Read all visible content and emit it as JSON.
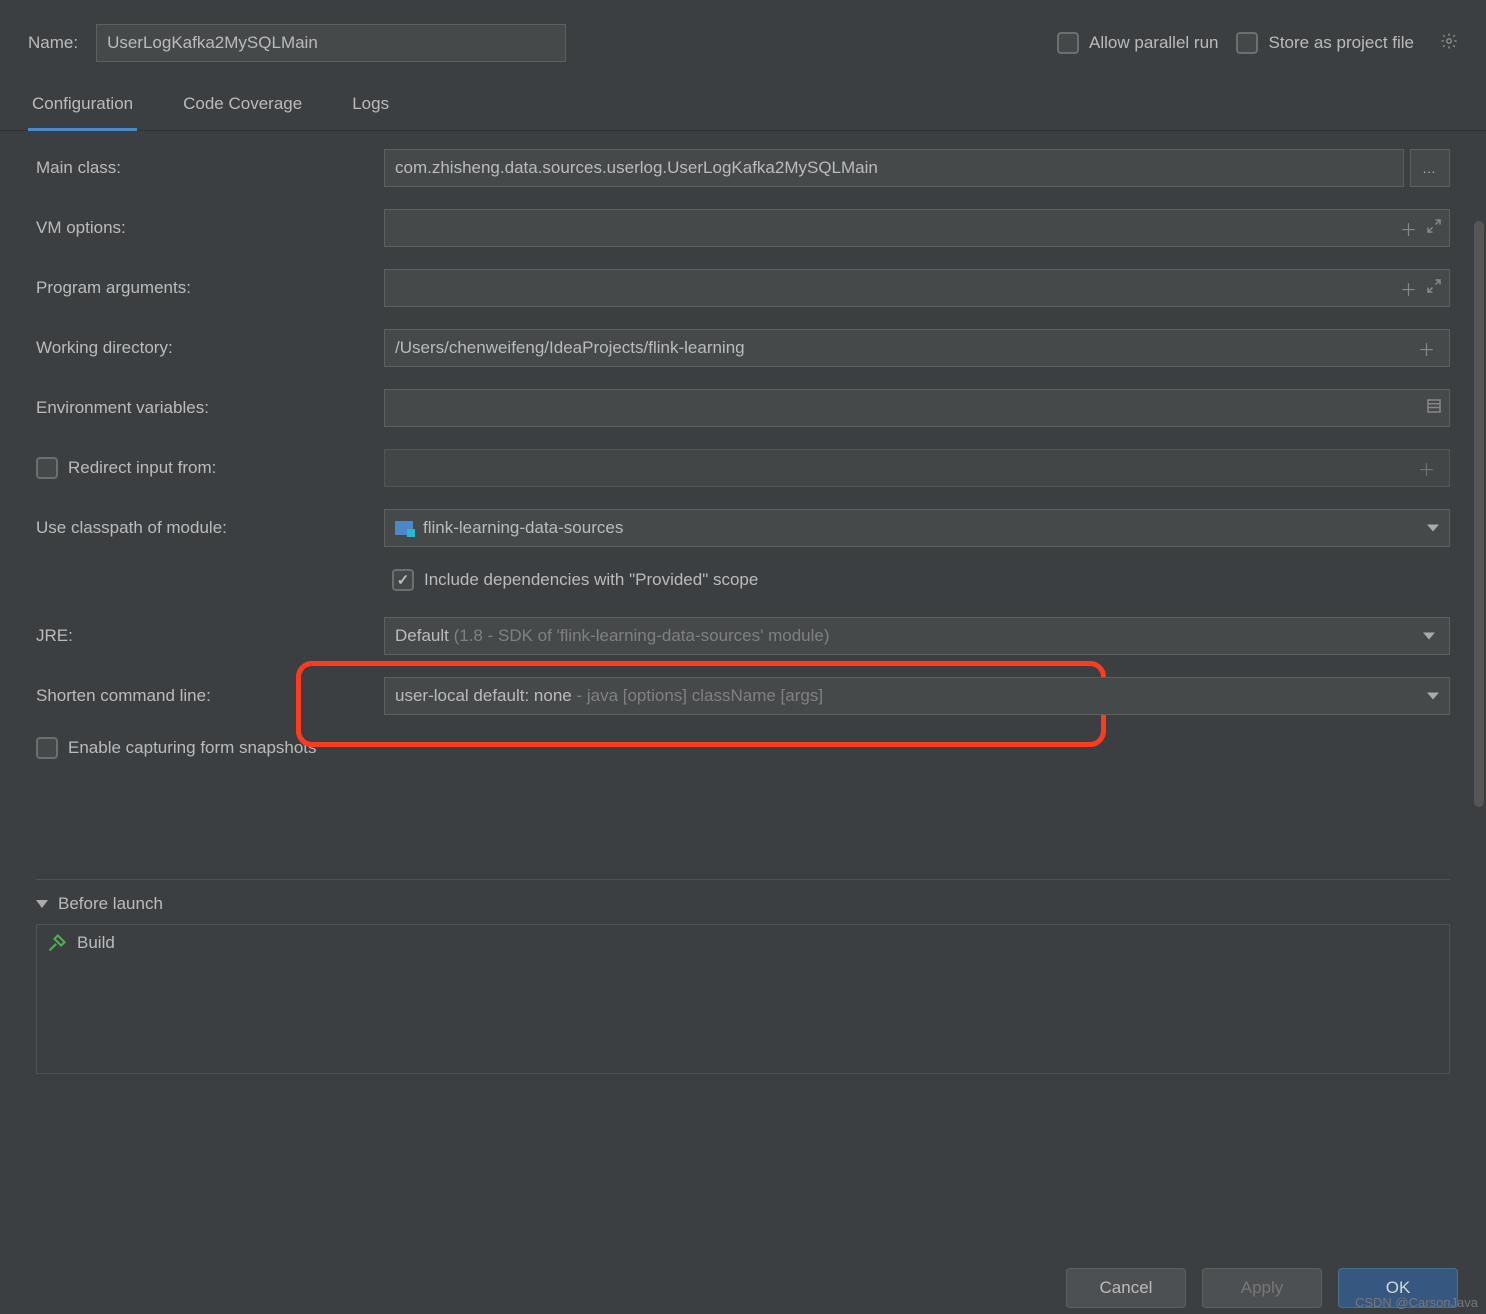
{
  "header": {
    "name_label": "Name:",
    "name_value": "UserLogKafka2MySQLMain",
    "allow_parallel": "Allow parallel run",
    "store_project": "Store as project file"
  },
  "tabs": [
    "Configuration",
    "Code Coverage",
    "Logs"
  ],
  "fields": {
    "main_class_label": "Main class:",
    "main_class_value": "com.zhisheng.data.sources.userlog.UserLogKafka2MySQLMain",
    "vm_options_label": "VM options:",
    "vm_options_value": "",
    "program_args_label": "Program arguments:",
    "program_args_value": "",
    "working_dir_label": "Working directory:",
    "working_dir_value": "/Users/chenweifeng/IdeaProjects/flink-learning",
    "env_vars_label": "Environment variables:",
    "env_vars_value": "",
    "redirect_input_label": "Redirect input from:",
    "redirect_input_value": "",
    "classpath_label": "Use classpath of module:",
    "classpath_value": "flink-learning-data-sources",
    "include_deps_label": "Include dependencies with \"Provided\" scope",
    "jre_label": "JRE:",
    "jre_value_main": "Default",
    "jre_value_hint": " (1.8 - SDK of 'flink-learning-data-sources' module)",
    "shorten_label": "Shorten command line:",
    "shorten_value_main": "user-local default: none",
    "shorten_value_hint": " - java [options] className [args]",
    "enable_capture_label": "Enable capturing form snapshots"
  },
  "before_launch": {
    "title": "Before launch",
    "items": [
      "Build"
    ]
  },
  "buttons": {
    "cancel": "Cancel",
    "apply": "Apply",
    "ok": "OK"
  },
  "watermark": "CSDN @CarsonJava"
}
